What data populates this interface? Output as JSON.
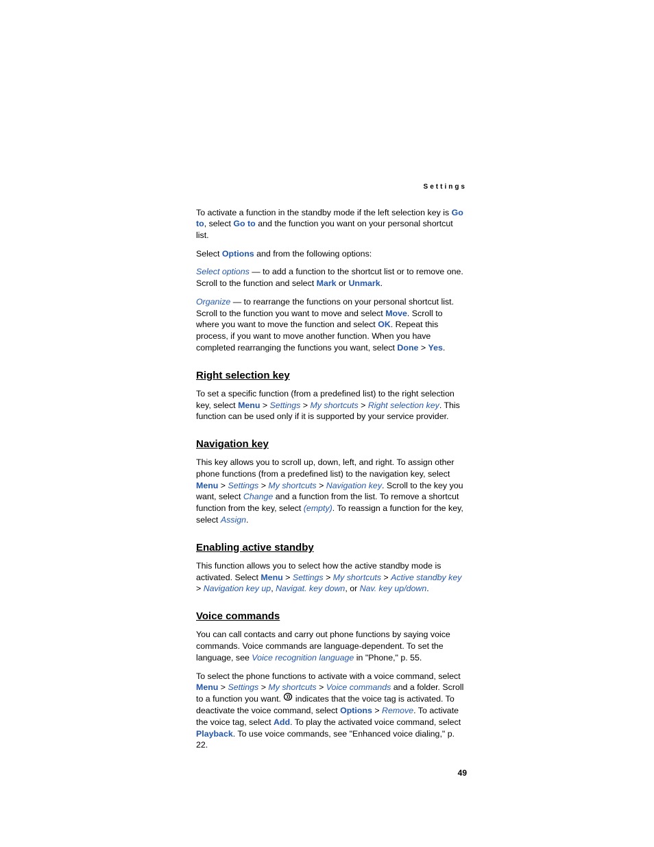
{
  "header": {
    "section": "Settings"
  },
  "p1": {
    "t1": "To activate a function in the standby mode if the left selection key is ",
    "goto1": "Go to",
    "t2": ", select ",
    "goto2": "Go to",
    "t3": " and the function you want on your personal shortcut list."
  },
  "p2": {
    "t1": "Select ",
    "options": "Options",
    "t2": " and from the following options:"
  },
  "p3": {
    "selopt": "Select options",
    "t1": " — to add a function to the shortcut list or to remove one. Scroll to the function and select ",
    "mark": "Mark",
    "t2": " or ",
    "unmark": "Unmark",
    "t3": "."
  },
  "p4": {
    "organize": "Organize",
    "t1": " — to rearrange the functions on your personal shortcut list. Scroll to the function you want to move and select ",
    "move": "Move",
    "t2": ". Scroll to where you want to move the function and select ",
    "ok": "OK",
    "t3": ". Repeat this process, if you want to move another function. When you have completed rearranging the functions you want, select ",
    "done": "Done",
    "gt": " > ",
    "yes": "Yes",
    "t4": "."
  },
  "s1": {
    "title": "Right selection key"
  },
  "p5": {
    "t1": "To set a specific function (from a predefined list) to the right selection key, select ",
    "menu": "Menu",
    "gt1": " > ",
    "settings": "Settings",
    "gt2": " > ",
    "mysc": "My shortcuts",
    "gt3": " > ",
    "rsk": "Right selection key",
    "t2": ". This function can be used only if it is supported by your service provider."
  },
  "s2": {
    "title": "Navigation key"
  },
  "p6": {
    "t1": "This key allows you to scroll up, down, left, and right. To assign other phone functions (from a predefined list) to the navigation key, select ",
    "menu": "Menu",
    "gt1": " > ",
    "settings": "Settings",
    "gt2": " > ",
    "mysc": "My shortcuts",
    "gt3": " > ",
    "navkey": "Navigation key",
    "t2": ". Scroll to the key you want, select ",
    "change": "Change",
    "t3": " and a function from the list. To remove a shortcut function from the key, select ",
    "empty": "(empty)",
    "t4": ". To reassign a function for the key, select ",
    "assign": "Assign",
    "t5": "."
  },
  "s3": {
    "title": "Enabling active standby"
  },
  "p7": {
    "t1": "This function allows you to select how the active standby mode is activated. Select ",
    "menu": "Menu",
    "gt1": " > ",
    "settings": "Settings",
    "gt2": " > ",
    "mysc": "My shortcuts",
    "gt3": " > ",
    "ask": "Active standby key",
    "gt4": " > ",
    "navup": "Navigation key up",
    "t2": ", ",
    "navdown": "Navigat. key down",
    "t3": ", or ",
    "navud": "Nav. key up/down",
    "t4": "."
  },
  "s4": {
    "title": "Voice commands"
  },
  "p8": {
    "t1": "You can call contacts and carry out phone functions by saying voice commands. Voice commands are language-dependent. To set the language, see ",
    "vrl": "Voice recognition language",
    "t2": " in \"Phone,\" p. 55."
  },
  "p9": {
    "t1": "To select the phone functions to activate with a voice command, select ",
    "menu": "Menu",
    "gt1": " > ",
    "settings": "Settings",
    "gt2": " > ",
    "mysc": "My shortcuts",
    "gt3": " > ",
    "vc": "Voice commands",
    "t2": " and a folder. Scroll to a function you want. ",
    "t3": " indicates that the voice tag is activated. To deactivate the voice command, select ",
    "options": "Options",
    "gt4": " > ",
    "remove": "Remove",
    "t4": ". To activate the voice tag, select ",
    "add": "Add",
    "t5": ". To play the activated voice command, select ",
    "playback": "Playback",
    "t6": ". To use voice commands, see \"Enhanced voice dialing,\" p. 22."
  },
  "footer": {
    "page": "49"
  }
}
